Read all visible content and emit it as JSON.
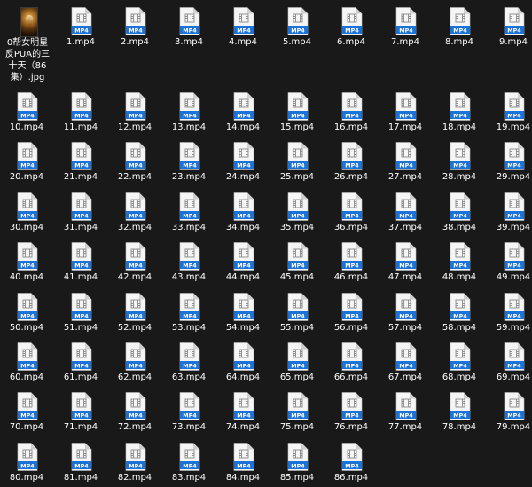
{
  "folder": {
    "image_file": {
      "name": "0帮女明星反PUA的三十天（86集）.jpg",
      "lines": [
        "0帮女明星",
        "反PUA的三",
        "十天（86",
        "集）.jpg"
      ],
      "icon": "image-thumbnail"
    },
    "file_icon": "mp4-file-icon",
    "icon_badge_text": "MP4",
    "badge_color": "#1b73d8",
    "page_color": "#f5f5f5",
    "fold_color": "#cfcfcf",
    "video_files": [
      "1.mp4",
      "2.mp4",
      "3.mp4",
      "4.mp4",
      "5.mp4",
      "6.mp4",
      "7.mp4",
      "8.mp4",
      "9.mp4",
      "10.mp4",
      "11.mp4",
      "12.mp4",
      "13.mp4",
      "14.mp4",
      "15.mp4",
      "16.mp4",
      "17.mp4",
      "18.mp4",
      "19.mp4",
      "20.mp4",
      "21.mp4",
      "22.mp4",
      "23.mp4",
      "24.mp4",
      "25.mp4",
      "26.mp4",
      "27.mp4",
      "28.mp4",
      "29.mp4",
      "30.mp4",
      "31.mp4",
      "32.mp4",
      "33.mp4",
      "34.mp4",
      "35.mp4",
      "36.mp4",
      "37.mp4",
      "38.mp4",
      "39.mp4",
      "40.mp4",
      "41.mp4",
      "42.mp4",
      "43.mp4",
      "44.mp4",
      "45.mp4",
      "46.mp4",
      "47.mp4",
      "48.mp4",
      "49.mp4",
      "50.mp4",
      "51.mp4",
      "52.mp4",
      "53.mp4",
      "54.mp4",
      "55.mp4",
      "56.mp4",
      "57.mp4",
      "58.mp4",
      "59.mp4",
      "60.mp4",
      "61.mp4",
      "62.mp4",
      "63.mp4",
      "64.mp4",
      "65.mp4",
      "66.mp4",
      "67.mp4",
      "68.mp4",
      "69.mp4",
      "70.mp4",
      "71.mp4",
      "72.mp4",
      "73.mp4",
      "74.mp4",
      "75.mp4",
      "76.mp4",
      "77.mp4",
      "78.mp4",
      "79.mp4",
      "80.mp4",
      "81.mp4",
      "82.mp4",
      "83.mp4",
      "84.mp4",
      "85.mp4",
      "86.mp4"
    ]
  }
}
